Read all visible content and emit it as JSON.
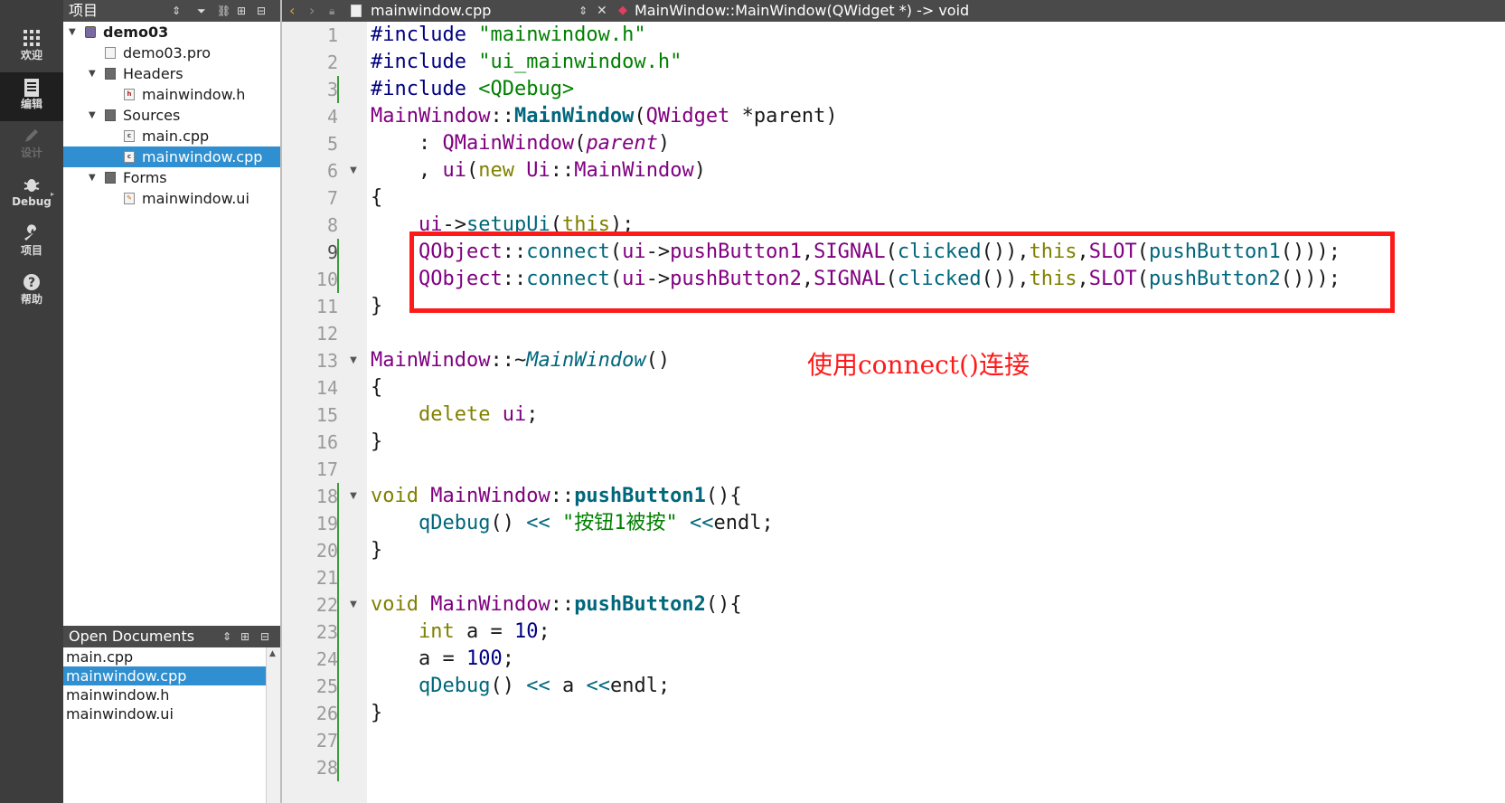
{
  "modebar": {
    "items": [
      {
        "label": "欢迎",
        "icon": "grid-icon"
      },
      {
        "label": "编辑",
        "icon": "edit-doc-icon"
      },
      {
        "label": "设计",
        "icon": "pencil-icon"
      },
      {
        "label": "Debug",
        "icon": "bug-icon"
      },
      {
        "label": "项目",
        "icon": "wrench-icon"
      },
      {
        "label": "帮助",
        "icon": "help-icon"
      }
    ]
  },
  "project_panel": {
    "title": "项目",
    "tree": [
      {
        "label": "demo03",
        "level": 0,
        "kind": "project",
        "expanded": true
      },
      {
        "label": "demo03.pro",
        "level": 1,
        "kind": "pro-file"
      },
      {
        "label": "Headers",
        "level": 1,
        "kind": "folder",
        "expanded": true
      },
      {
        "label": "mainwindow.h",
        "level": 2,
        "kind": "header-file"
      },
      {
        "label": "Sources",
        "level": 1,
        "kind": "folder",
        "expanded": true
      },
      {
        "label": "main.cpp",
        "level": 2,
        "kind": "cpp-file"
      },
      {
        "label": "mainwindow.cpp",
        "level": 2,
        "kind": "cpp-file",
        "selected": true
      },
      {
        "label": "Forms",
        "level": 1,
        "kind": "folder",
        "expanded": true
      },
      {
        "label": "mainwindow.ui",
        "level": 2,
        "kind": "ui-file"
      }
    ]
  },
  "open_documents": {
    "title": "Open Documents",
    "items": [
      "main.cpp",
      "mainwindow.cpp",
      "mainwindow.h",
      "mainwindow.ui"
    ],
    "selected": "mainwindow.cpp"
  },
  "editor": {
    "file_name": "mainwindow.cpp",
    "symbol": "MainWindow::MainWindow(QWidget *) -> void",
    "current_line": 9,
    "lines": [
      "#include \"mainwindow.h\"",
      "#include \"ui_mainwindow.h\"",
      "#include <QDebug>",
      "MainWindow::MainWindow(QWidget *parent)",
      "    : QMainWindow(parent)",
      "    , ui(new Ui::MainWindow)",
      "{",
      "    ui->setupUi(this);",
      "    QObject::connect(ui->pushButton1,SIGNAL(clicked()),this,SLOT(pushButton1()));",
      "    QObject::connect(ui->pushButton2,SIGNAL(clicked()),this,SLOT(pushButton2()));",
      "}",
      "",
      "MainWindow::~MainWindow()",
      "{",
      "    delete ui;",
      "}",
      "",
      "void MainWindow::pushButton1(){",
      "    qDebug() << \"按钮1被按\" <<endl;",
      "}",
      "",
      "void MainWindow::pushButton2(){",
      "    int a = 10;",
      "    a = 100;",
      "    qDebug() << a <<endl;",
      "}",
      "",
      ""
    ],
    "fold_lines": [
      6,
      13,
      18,
      22
    ],
    "changed_lines": [
      3,
      9,
      10,
      18,
      19,
      20,
      21,
      22,
      23,
      24,
      25,
      26,
      27,
      28
    ]
  },
  "annotation": {
    "text": "使用connect()连接",
    "color": "#ff1a1a"
  },
  "colors": {
    "selection": "#2f8fd0",
    "toolbar": "#4a4a4a",
    "modebar": "#3d3d3d",
    "change_marker": "#3a9e3a"
  }
}
